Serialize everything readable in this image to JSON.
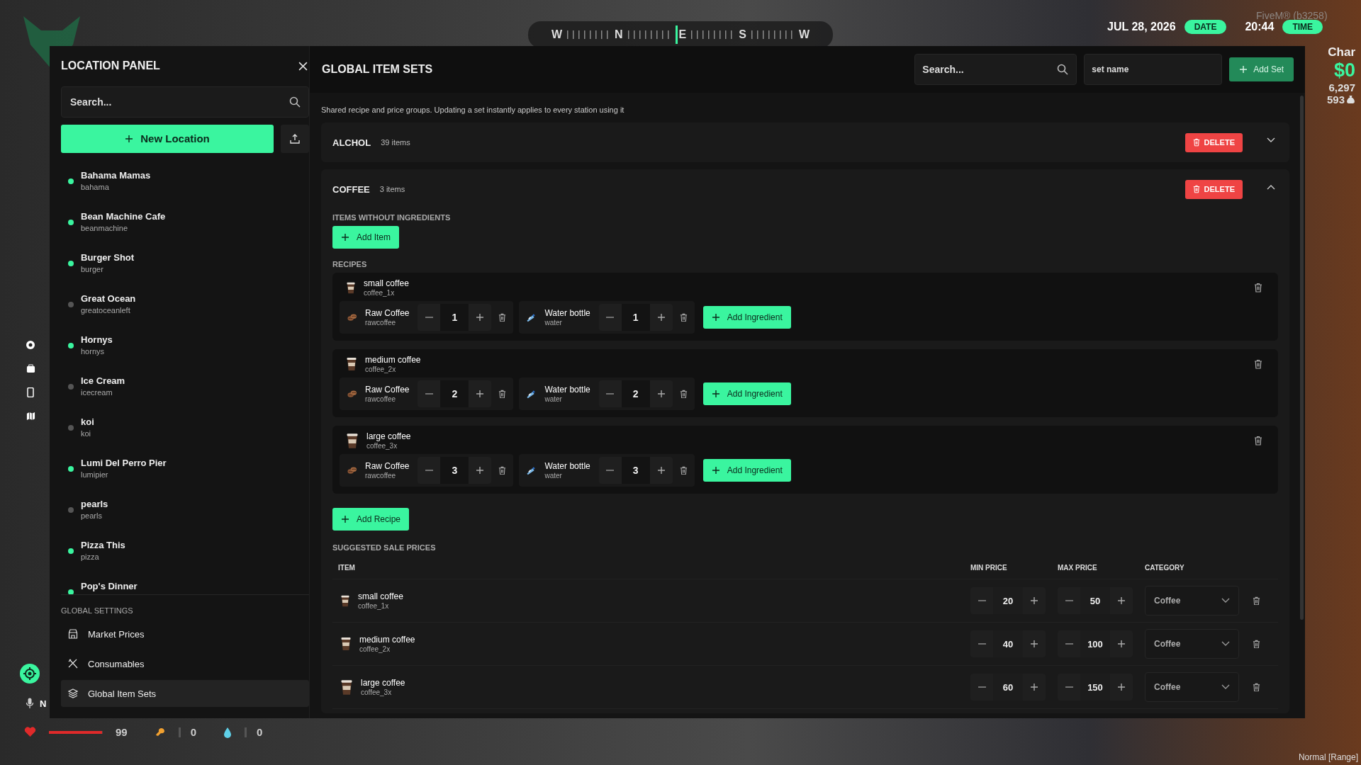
{
  "hud": {
    "compass": [
      "W",
      "N",
      "E",
      "S",
      "W"
    ],
    "date": "JUL 28, 2026",
    "date_label": "DATE",
    "time": "20:44",
    "time_label": "TIME",
    "build": "FiveM® (b3258)",
    "char_label": "Char",
    "cash": "$0",
    "bank": "6,297",
    "coins": "593",
    "mic_label": "N",
    "health": {
      "level": 0.99
    },
    "health_value": "99",
    "hunger_value": "0",
    "thirst_value": "0",
    "voice_mode": "Normal [Range]"
  },
  "location_panel": {
    "title": "LOCATION PANEL",
    "search": {
      "placeholder": "Search..."
    },
    "new_button": "New Location",
    "locations": [
      {
        "name": "Bahama Mamas",
        "code": "bahama",
        "active": true
      },
      {
        "name": "Bean Machine Cafe",
        "code": "beanmachine",
        "active": true
      },
      {
        "name": "Burger Shot",
        "code": "burger",
        "active": true
      },
      {
        "name": "Great Ocean",
        "code": "greatoceanleft",
        "active": false
      },
      {
        "name": "Hornys",
        "code": "hornys",
        "active": true
      },
      {
        "name": "Ice Cream",
        "code": "icecream",
        "active": false
      },
      {
        "name": "koi",
        "code": "koi",
        "active": false
      },
      {
        "name": "Lumi Del Perro Pier",
        "code": "lumipier",
        "active": true
      },
      {
        "name": "pearls",
        "code": "pearls",
        "active": false
      },
      {
        "name": "Pizza This",
        "code": "pizza",
        "active": true
      },
      {
        "name": "Pop's Dinner",
        "active": true
      }
    ],
    "settings_heading": "GLOBAL SETTINGS",
    "settings_items": [
      {
        "label": "Market Prices",
        "selected": false
      },
      {
        "label": "Consumables",
        "selected": false
      },
      {
        "label": "Global Item Sets",
        "selected": true
      }
    ]
  },
  "item_sets": {
    "title": "GLOBAL ITEM SETS",
    "search": {
      "placeholder": "Search..."
    },
    "name_field": {
      "placeholder": "set name"
    },
    "add_set": "Add Set",
    "description": "Shared recipe and price groups. Updating a set instantly applies to every station using it",
    "sets": [
      {
        "name": "ALCHOL",
        "count": "39 items",
        "delete": "DELETE",
        "expanded": false
      },
      {
        "name": "COFFEE",
        "count": "3 items",
        "delete": "DELETE",
        "expanded": true,
        "plain_heading": "ITEMS WITHOUT INGREDIENTS",
        "add_item": "Add Item",
        "recipes_heading": "RECIPES",
        "recipes": [
          {
            "name": "small coffee",
            "code": "coffee_1x",
            "add_ingredient": "Add Ingredient",
            "ingredients": [
              {
                "name": "Raw Coffee",
                "code": "rawcoffee",
                "qty": "1"
              },
              {
                "name": "Water bottle",
                "code": "water",
                "qty": "1"
              }
            ]
          },
          {
            "name": "medium coffee",
            "code": "coffee_2x",
            "add_ingredient": "Add Ingredient",
            "ingredients": [
              {
                "name": "Raw Coffee",
                "code": "rawcoffee",
                "qty": "2"
              },
              {
                "name": "Water bottle",
                "code": "water",
                "qty": "2"
              }
            ]
          },
          {
            "name": "large coffee",
            "code": "coffee_3x",
            "add_ingredient": "Add Ingredient",
            "ingredients": [
              {
                "name": "Raw Coffee",
                "code": "rawcoffee",
                "qty": "3"
              },
              {
                "name": "Water bottle",
                "code": "water",
                "qty": "3"
              }
            ]
          }
        ],
        "add_recipe": "Add Recipe",
        "prices_heading": "SUGGESTED SALE PRICES",
        "price_columns": [
          "ITEM",
          "MIN PRICE",
          "MAX PRICE",
          "CATEGORY"
        ],
        "prices": [
          {
            "name": "small coffee",
            "code": "coffee_1x",
            "min": "20",
            "max": "50",
            "category": "Coffee"
          },
          {
            "name": "medium coffee",
            "code": "coffee_2x",
            "min": "40",
            "max": "100",
            "category": "Coffee"
          },
          {
            "name": "large coffee",
            "code": "coffee_3x",
            "min": "60",
            "max": "150",
            "category": "Coffee"
          }
        ]
      }
    ]
  }
}
